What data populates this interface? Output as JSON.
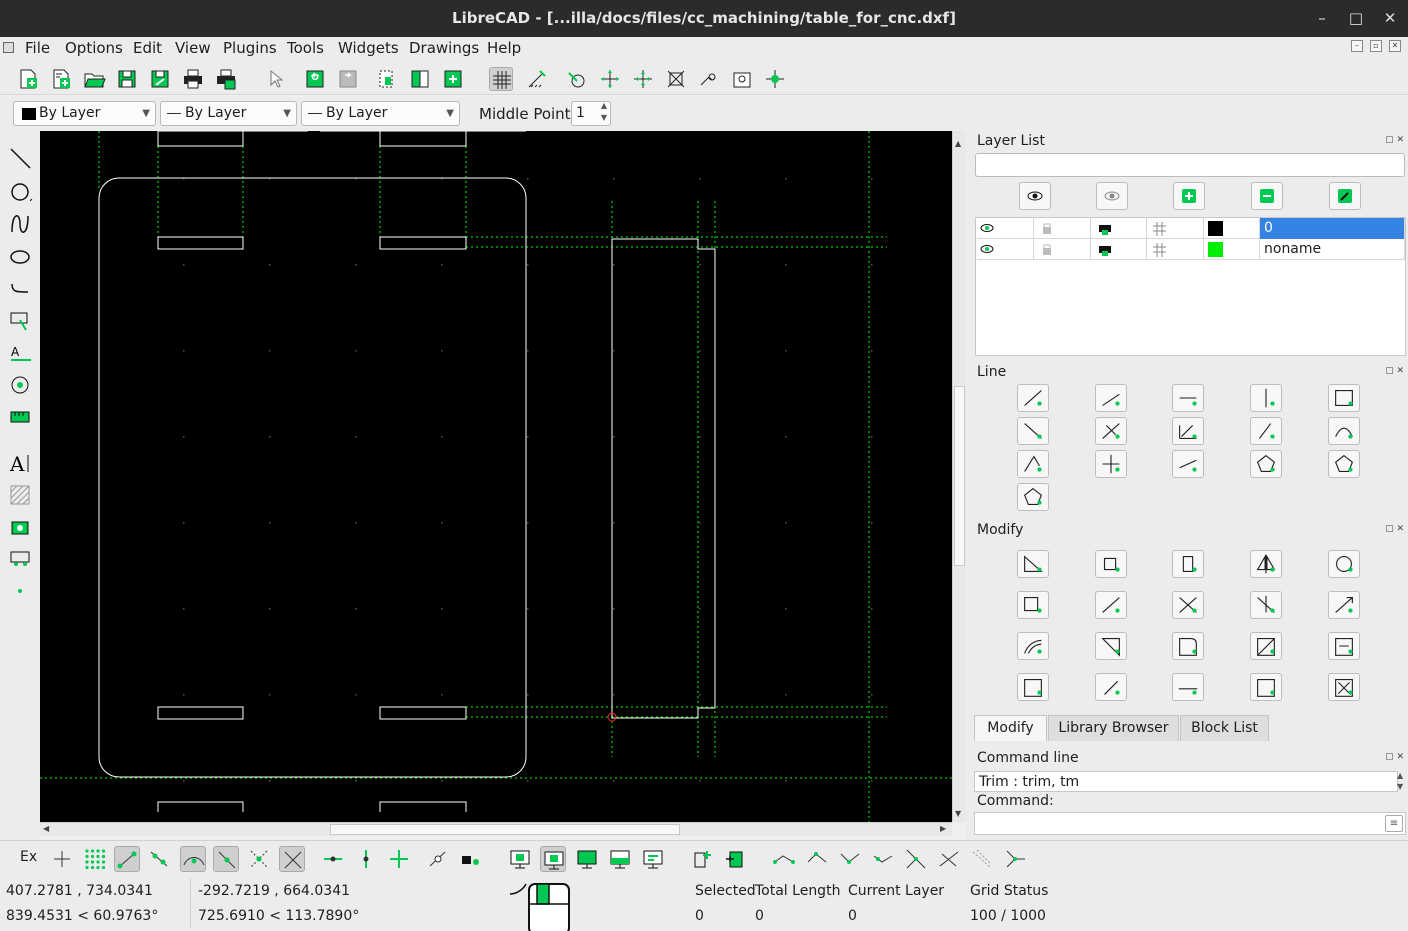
{
  "window": {
    "title": "LibreCAD - [...illa/docs/files/cc_machining/table_for_cnc.dxf]",
    "minimize": "–",
    "maximize": "□",
    "close": "✕"
  },
  "menu": [
    "File",
    "Options",
    "Edit",
    "View",
    "Plugins",
    "Tools",
    "Widgets",
    "Drawings",
    "Help"
  ],
  "pen": {
    "color": "By Layer",
    "line_type": "By Layer",
    "line_width": "By Layer",
    "middle_points_label": "Middle Points",
    "middle_points_value": "1"
  },
  "layer_list": {
    "title": "Layer List",
    "filter_placeholder": "",
    "layers": [
      {
        "name": "0",
        "color": "#000000",
        "selected": true
      },
      {
        "name": "noname",
        "color": "#00ee00",
        "selected": false
      }
    ]
  },
  "line_dock": {
    "title": "Line"
  },
  "modify_dock": {
    "title": "Modify"
  },
  "tabs": [
    "Modify",
    "Library Browser",
    "Block List"
  ],
  "command": {
    "title": "Command line",
    "history": "Trim : trim, tm",
    "prompt": "Command:",
    "input": ""
  },
  "snap": {
    "exclusive_label": "Ex"
  },
  "status": {
    "abs_coord": "407.2781 , 734.0341",
    "abs_polar": "839.4531 < 60.9763°",
    "rel_coord": "-292.7219 , 664.0341",
    "rel_polar": "725.6910 < 113.7890°",
    "selected_label": "Selected",
    "selected_value": "0",
    "total_length_label": "Total Length",
    "total_length_value": "0",
    "current_layer_label": "Current Layer",
    "current_layer_value": "0",
    "grid_status_label": "Grid Status",
    "grid_status_value": "100 / 1000"
  },
  "colors": {
    "accent_green": "#00c853",
    "canvas": "#000000",
    "selection_blue": "#3584e4",
    "grid_guide": "#00ff00"
  }
}
